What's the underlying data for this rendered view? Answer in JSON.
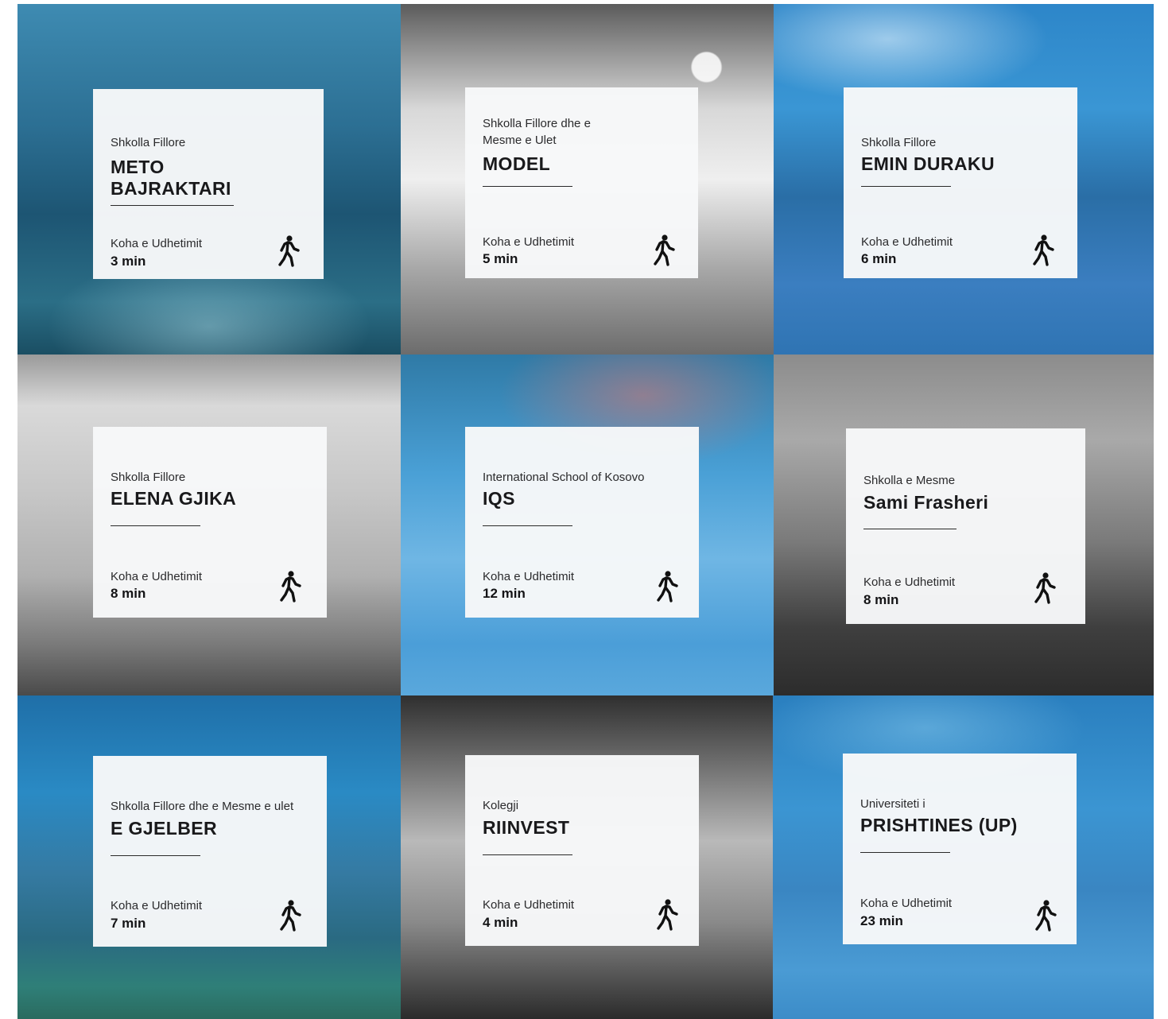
{
  "travel_label": "Koha e Udhetimit",
  "icon": "walking-person-icon",
  "schools": [
    {
      "category": "Shkolla Fillore",
      "name": "METO\nBAJRAKTARI",
      "time": "3 min"
    },
    {
      "category": "Shkolla Fillore dhe e\nMesme e Ulet",
      "name": "MODEL",
      "time": "5 min"
    },
    {
      "category": "Shkolla Fillore",
      "name": "EMIN DURAKU",
      "time": "6 min"
    },
    {
      "category": "Shkolla Fillore",
      "name": "ELENA GJIKA",
      "time": "8 min"
    },
    {
      "category": "International School of Kosovo",
      "name": "IQS",
      "time": "12 min"
    },
    {
      "category": "Shkolla e Mesme",
      "name": "Sami Frasheri",
      "time": "8 min"
    },
    {
      "category": "Shkolla Fillore dhe e Mesme e ulet",
      "name": "E GJELBER",
      "time": "7 min"
    },
    {
      "category": "Kolegji",
      "name": "RIINVEST",
      "time": "4 min"
    },
    {
      "category": "Universiteti i",
      "name": "PRISHTINES (UP)",
      "time": "23 min"
    }
  ]
}
